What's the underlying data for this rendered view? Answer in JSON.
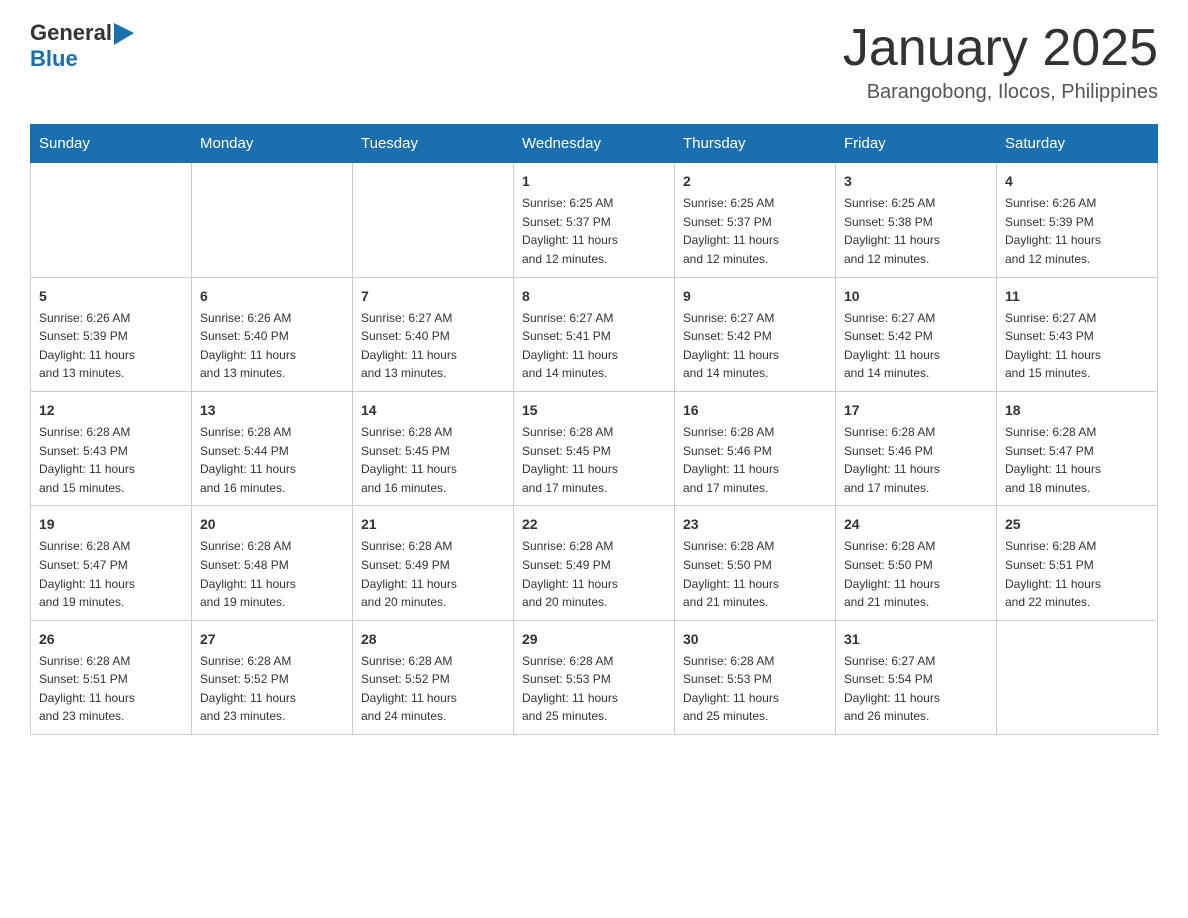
{
  "logo": {
    "text_general": "General",
    "text_blue": "Blue"
  },
  "header": {
    "title": "January 2025",
    "subtitle": "Barangobong, Ilocos, Philippines"
  },
  "days_of_week": [
    "Sunday",
    "Monday",
    "Tuesday",
    "Wednesday",
    "Thursday",
    "Friday",
    "Saturday"
  ],
  "weeks": [
    [
      {
        "day": "",
        "info": ""
      },
      {
        "day": "",
        "info": ""
      },
      {
        "day": "",
        "info": ""
      },
      {
        "day": "1",
        "info": "Sunrise: 6:25 AM\nSunset: 5:37 PM\nDaylight: 11 hours\nand 12 minutes."
      },
      {
        "day": "2",
        "info": "Sunrise: 6:25 AM\nSunset: 5:37 PM\nDaylight: 11 hours\nand 12 minutes."
      },
      {
        "day": "3",
        "info": "Sunrise: 6:25 AM\nSunset: 5:38 PM\nDaylight: 11 hours\nand 12 minutes."
      },
      {
        "day": "4",
        "info": "Sunrise: 6:26 AM\nSunset: 5:39 PM\nDaylight: 11 hours\nand 12 minutes."
      }
    ],
    [
      {
        "day": "5",
        "info": "Sunrise: 6:26 AM\nSunset: 5:39 PM\nDaylight: 11 hours\nand 13 minutes."
      },
      {
        "day": "6",
        "info": "Sunrise: 6:26 AM\nSunset: 5:40 PM\nDaylight: 11 hours\nand 13 minutes."
      },
      {
        "day": "7",
        "info": "Sunrise: 6:27 AM\nSunset: 5:40 PM\nDaylight: 11 hours\nand 13 minutes."
      },
      {
        "day": "8",
        "info": "Sunrise: 6:27 AM\nSunset: 5:41 PM\nDaylight: 11 hours\nand 14 minutes."
      },
      {
        "day": "9",
        "info": "Sunrise: 6:27 AM\nSunset: 5:42 PM\nDaylight: 11 hours\nand 14 minutes."
      },
      {
        "day": "10",
        "info": "Sunrise: 6:27 AM\nSunset: 5:42 PM\nDaylight: 11 hours\nand 14 minutes."
      },
      {
        "day": "11",
        "info": "Sunrise: 6:27 AM\nSunset: 5:43 PM\nDaylight: 11 hours\nand 15 minutes."
      }
    ],
    [
      {
        "day": "12",
        "info": "Sunrise: 6:28 AM\nSunset: 5:43 PM\nDaylight: 11 hours\nand 15 minutes."
      },
      {
        "day": "13",
        "info": "Sunrise: 6:28 AM\nSunset: 5:44 PM\nDaylight: 11 hours\nand 16 minutes."
      },
      {
        "day": "14",
        "info": "Sunrise: 6:28 AM\nSunset: 5:45 PM\nDaylight: 11 hours\nand 16 minutes."
      },
      {
        "day": "15",
        "info": "Sunrise: 6:28 AM\nSunset: 5:45 PM\nDaylight: 11 hours\nand 17 minutes."
      },
      {
        "day": "16",
        "info": "Sunrise: 6:28 AM\nSunset: 5:46 PM\nDaylight: 11 hours\nand 17 minutes."
      },
      {
        "day": "17",
        "info": "Sunrise: 6:28 AM\nSunset: 5:46 PM\nDaylight: 11 hours\nand 17 minutes."
      },
      {
        "day": "18",
        "info": "Sunrise: 6:28 AM\nSunset: 5:47 PM\nDaylight: 11 hours\nand 18 minutes."
      }
    ],
    [
      {
        "day": "19",
        "info": "Sunrise: 6:28 AM\nSunset: 5:47 PM\nDaylight: 11 hours\nand 19 minutes."
      },
      {
        "day": "20",
        "info": "Sunrise: 6:28 AM\nSunset: 5:48 PM\nDaylight: 11 hours\nand 19 minutes."
      },
      {
        "day": "21",
        "info": "Sunrise: 6:28 AM\nSunset: 5:49 PM\nDaylight: 11 hours\nand 20 minutes."
      },
      {
        "day": "22",
        "info": "Sunrise: 6:28 AM\nSunset: 5:49 PM\nDaylight: 11 hours\nand 20 minutes."
      },
      {
        "day": "23",
        "info": "Sunrise: 6:28 AM\nSunset: 5:50 PM\nDaylight: 11 hours\nand 21 minutes."
      },
      {
        "day": "24",
        "info": "Sunrise: 6:28 AM\nSunset: 5:50 PM\nDaylight: 11 hours\nand 21 minutes."
      },
      {
        "day": "25",
        "info": "Sunrise: 6:28 AM\nSunset: 5:51 PM\nDaylight: 11 hours\nand 22 minutes."
      }
    ],
    [
      {
        "day": "26",
        "info": "Sunrise: 6:28 AM\nSunset: 5:51 PM\nDaylight: 11 hours\nand 23 minutes."
      },
      {
        "day": "27",
        "info": "Sunrise: 6:28 AM\nSunset: 5:52 PM\nDaylight: 11 hours\nand 23 minutes."
      },
      {
        "day": "28",
        "info": "Sunrise: 6:28 AM\nSunset: 5:52 PM\nDaylight: 11 hours\nand 24 minutes."
      },
      {
        "day": "29",
        "info": "Sunrise: 6:28 AM\nSunset: 5:53 PM\nDaylight: 11 hours\nand 25 minutes."
      },
      {
        "day": "30",
        "info": "Sunrise: 6:28 AM\nSunset: 5:53 PM\nDaylight: 11 hours\nand 25 minutes."
      },
      {
        "day": "31",
        "info": "Sunrise: 6:27 AM\nSunset: 5:54 PM\nDaylight: 11 hours\nand 26 minutes."
      },
      {
        "day": "",
        "info": ""
      }
    ]
  ]
}
